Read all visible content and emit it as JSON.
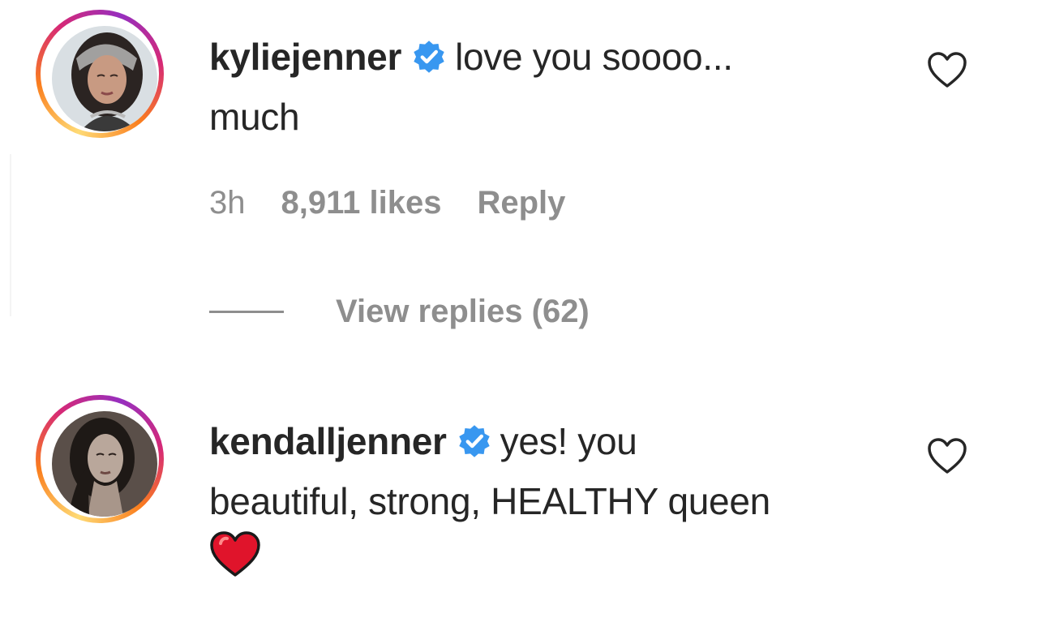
{
  "comments": [
    {
      "username": "kyliejenner",
      "text_line1": "love you soooo...",
      "text_line2": "much",
      "time": "3h",
      "likes": "8,911 likes",
      "reply_label": "Reply",
      "view_replies": "View replies (62)"
    },
    {
      "username": "kendalljenner",
      "text_line1": "yes! you",
      "text_line2": "beautiful, strong, HEALTHY queen"
    }
  ],
  "colors": {
    "verified_badge": "#3897f0",
    "muted_text": "#8e8e8e",
    "primary_text": "#262626",
    "heart_emoji": "#e0142b"
  },
  "icons": {
    "verified": "verified-badge-icon",
    "like": "heart-outline-icon",
    "emoji": "red-heart-emoji"
  }
}
